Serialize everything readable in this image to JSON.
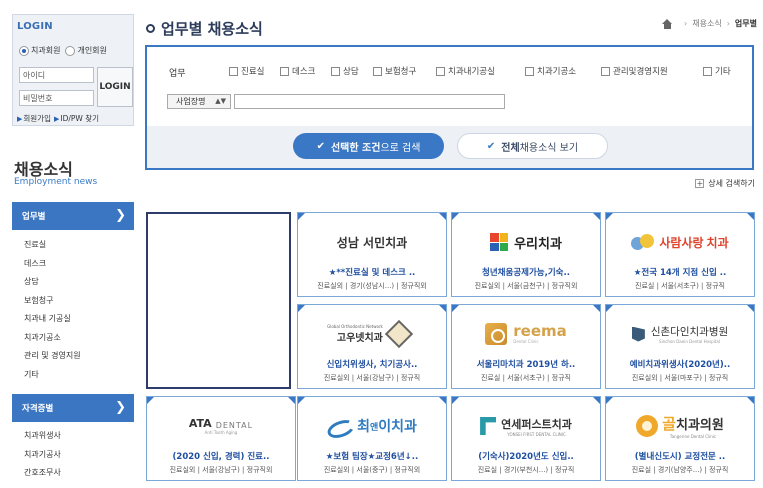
{
  "login": {
    "title": "LOGIN",
    "radio_dentist": "치과회원",
    "radio_individual": "개인회원",
    "id_placeholder": "아이디",
    "pw_placeholder": "비밀번호",
    "login_button": "LOGIN",
    "signup_link": "회원가입",
    "find_link": "ID/PW 찾기"
  },
  "section": {
    "title": "채용소식",
    "subtitle": "Employment news"
  },
  "menu_job": {
    "header": "업무별",
    "items": [
      "진료실",
      "데스크",
      "상담",
      "보험청구",
      "치과내 기공실",
      "치과기공소",
      "관리 및 경영지원",
      "기타"
    ]
  },
  "menu_license": {
    "header": "자격증별",
    "items": [
      "치과위생사",
      "치과기공사",
      "간호조무사"
    ]
  },
  "page": {
    "title": "업무별 채용소식"
  },
  "breadcrumb": {
    "items": [
      "채용소식",
      "업무별"
    ]
  },
  "search": {
    "job_label": "업무",
    "checkboxes": [
      "진료실",
      "데스크",
      "상담",
      "보험청구",
      "치과내기공실",
      "치과기공소",
      "관리및경영지원",
      "기타"
    ],
    "select_value": "사업장명",
    "search_button_bold": "선택한 조건",
    "search_button_rest": "으로 검색",
    "all_button_bold": "전체",
    "all_button_rest": " 채용소식 보기",
    "detail_link": "상세 검색하기"
  },
  "cards": [
    {
      "logo": "성남 서민치과",
      "title": "★**진료실 및 데스크 ..",
      "meta": "진료실외 | 경기(성남시...) | 정규직외"
    },
    {
      "logo": "우리치과",
      "title": "청년채움공제가능,기숙..",
      "meta": "진료실외 | 서울(금천구) | 정규직외"
    },
    {
      "logo_a": "사람사랑",
      "logo_b": "치과",
      "title": "★전국 14개 지점 신입 ..",
      "meta": "진료실 | 서울(서초구) | 정규직"
    },
    {
      "logo_a": "Global Orthodontic Network",
      "logo_b": "고우넷치과",
      "title": "신입치위생사, 치기공사..",
      "meta": "진료실외 | 서울(강남구) | 정규직"
    },
    {
      "logo_a": "reema",
      "logo_b": "Dental Clinic",
      "title": "서울리마치과 2019년 하..",
      "meta": "진료실 | 서울(서초구) | 정규직"
    },
    {
      "logo_a": "신촌다인치과병원",
      "logo_b": "Sinchon Daein Dental Hospital",
      "title": "예비치과위생사(2020년)..",
      "meta": "진료실외 | 서울(마포구) | 정규직"
    },
    {
      "logo_a": "ATA",
      "logo_b": "DENTAL",
      "logo_c": "Anti Tooth Aging",
      "title": "(2020 신입, 경력) 진료..",
      "meta": "진료실외 | 서울(강남구) | 정규직외"
    },
    {
      "logo_a": "최",
      "logo_b": "앤",
      "logo_c": "이치과",
      "title": "★보험 팀장★교정6년↓..",
      "meta": "진료실외 | 서울(중구) | 정규직외"
    },
    {
      "logo_a": "연세퍼스트치과",
      "logo_b": "YONSEI FIRST DENTAL CLINIC",
      "title": "(기숙사)2020년도 신입..",
      "meta": "진료실 | 경기(부천시...) | 정규직"
    },
    {
      "logo_a": "골",
      "logo_b": "치과의원",
      "logo_c": "Tangerine Dental Clinic",
      "title": "(별내신도시) 교정전문 ..",
      "meta": "진료실 | 경기(남양주...) | 정규직"
    }
  ],
  "colors": {
    "accent": "#3a77c4",
    "title": "#2d3c5a",
    "link": "#1f4fa0",
    "sarang_red": "#e0432c",
    "reema_gold": "#d4a24a",
    "choi_blue": "#2f7bc0",
    "golden_orange": "#f0a82a"
  }
}
